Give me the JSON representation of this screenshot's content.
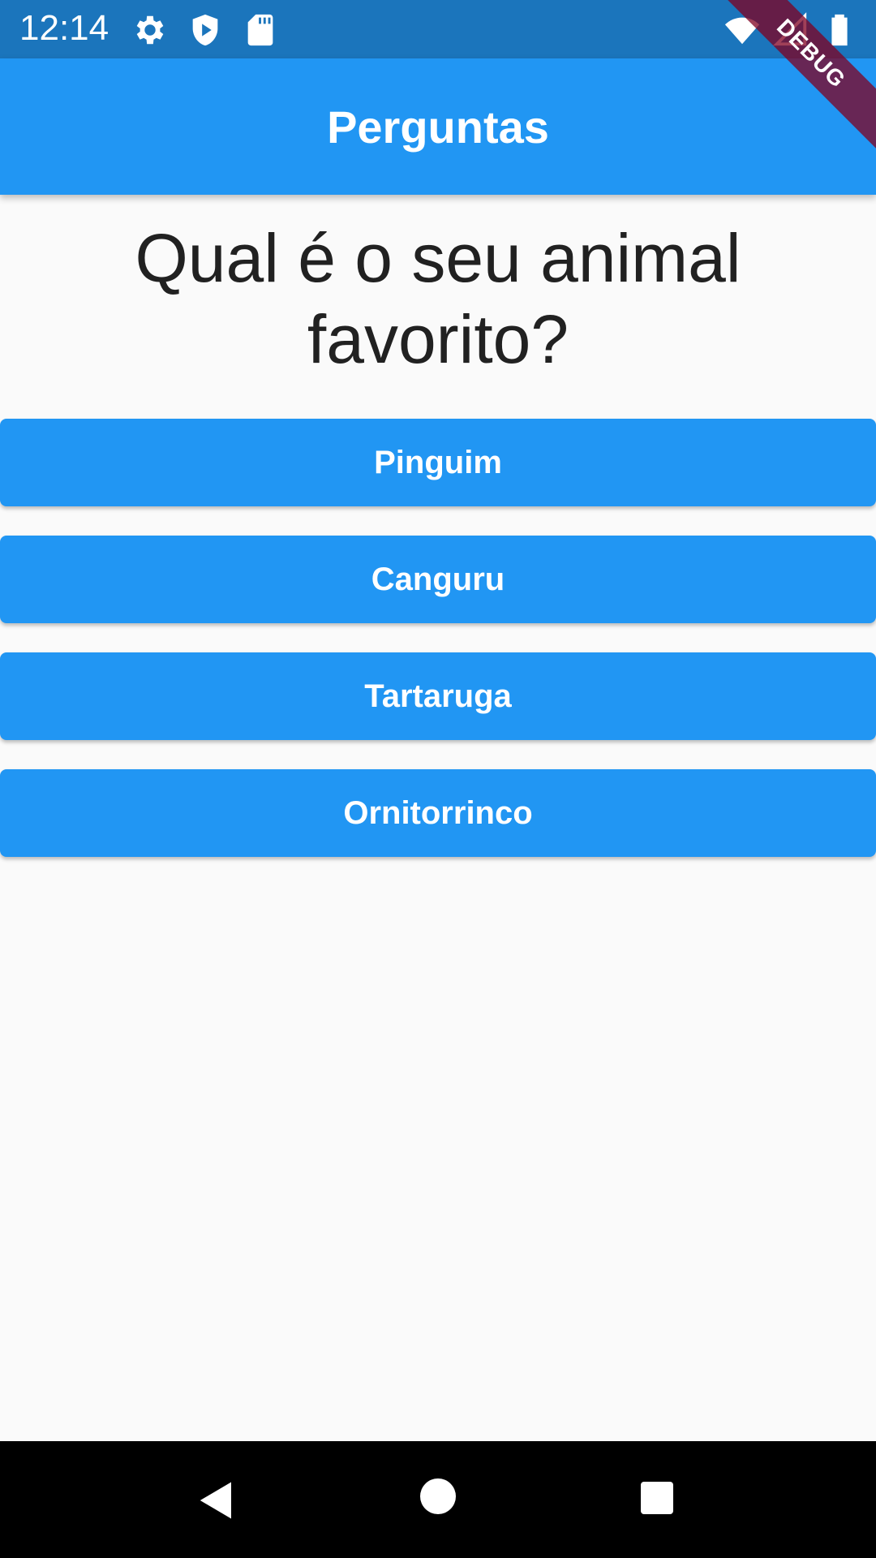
{
  "status_bar": {
    "time": "12:14",
    "left_icons": [
      "gear-icon",
      "shield-play-icon",
      "sd-card-icon"
    ],
    "right_icons": [
      "wifi-icon",
      "cell-signal-icon",
      "battery-icon"
    ],
    "color": "#1b75bc"
  },
  "app_bar": {
    "title": "Perguntas",
    "color": "#2196f3"
  },
  "debug_banner": {
    "label": "DEBUG"
  },
  "main": {
    "question": "Qual é o seu animal favorito?",
    "answers": [
      "Pinguim",
      "Canguru",
      "Tartaruga",
      "Ornitorrinco"
    ],
    "button_color": "#2196f3"
  },
  "nav_bar": {
    "icons": [
      "back-icon",
      "home-icon",
      "recents-icon"
    ]
  }
}
